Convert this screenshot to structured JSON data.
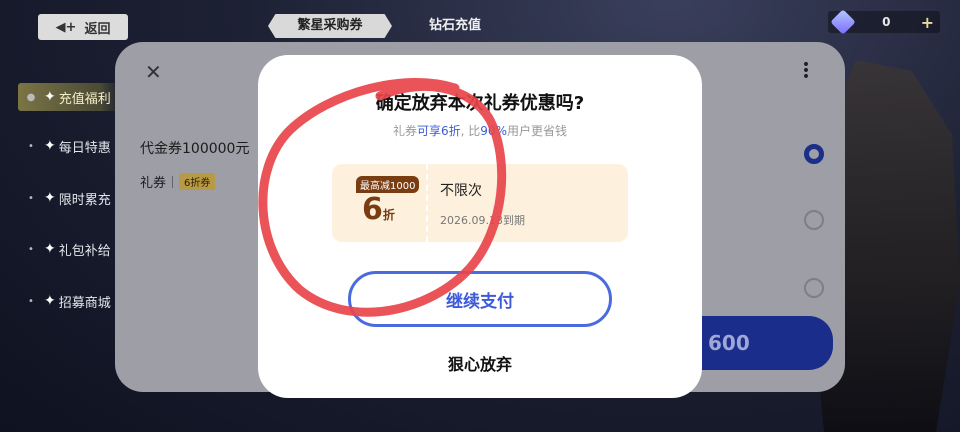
{
  "topbar": {
    "back_label": "返回",
    "tabs": [
      {
        "label": "繁星采购券",
        "active": true
      },
      {
        "label": "钻石充值",
        "active": false
      }
    ],
    "currency_amount": "0"
  },
  "side_menu": {
    "items": [
      {
        "label": "充值福利",
        "active": true
      },
      {
        "label": "每日特惠",
        "active": false
      },
      {
        "label": "限时累充",
        "active": false
      },
      {
        "label": "礼包补给",
        "active": false
      },
      {
        "label": "招募商城",
        "active": false
      }
    ]
  },
  "panel": {
    "voucher_text": "代金券100000元",
    "gift_label": "礼券",
    "gift_badge": "6折券",
    "pay_amount": "600"
  },
  "dialog": {
    "title": "确定放弃本次礼券优惠吗?",
    "subtitle_prefix": "礼券",
    "subtitle_highlight1": "可享6折",
    "subtitle_mid": ", 比",
    "subtitle_highlight2": "90%",
    "subtitle_suffix": "用户更省钱",
    "coupon": {
      "badge": "最高减1000",
      "discount_number": "6",
      "discount_unit": "折",
      "name": "不限次",
      "expiry": "2026.09.13到期"
    },
    "continue_label": "继续支付",
    "abandon_label": "狠心放弃"
  },
  "colors": {
    "accent_blue": "#4a6be0",
    "coupon_brown": "#7a3d12",
    "annotation_red": "#e8454a"
  }
}
